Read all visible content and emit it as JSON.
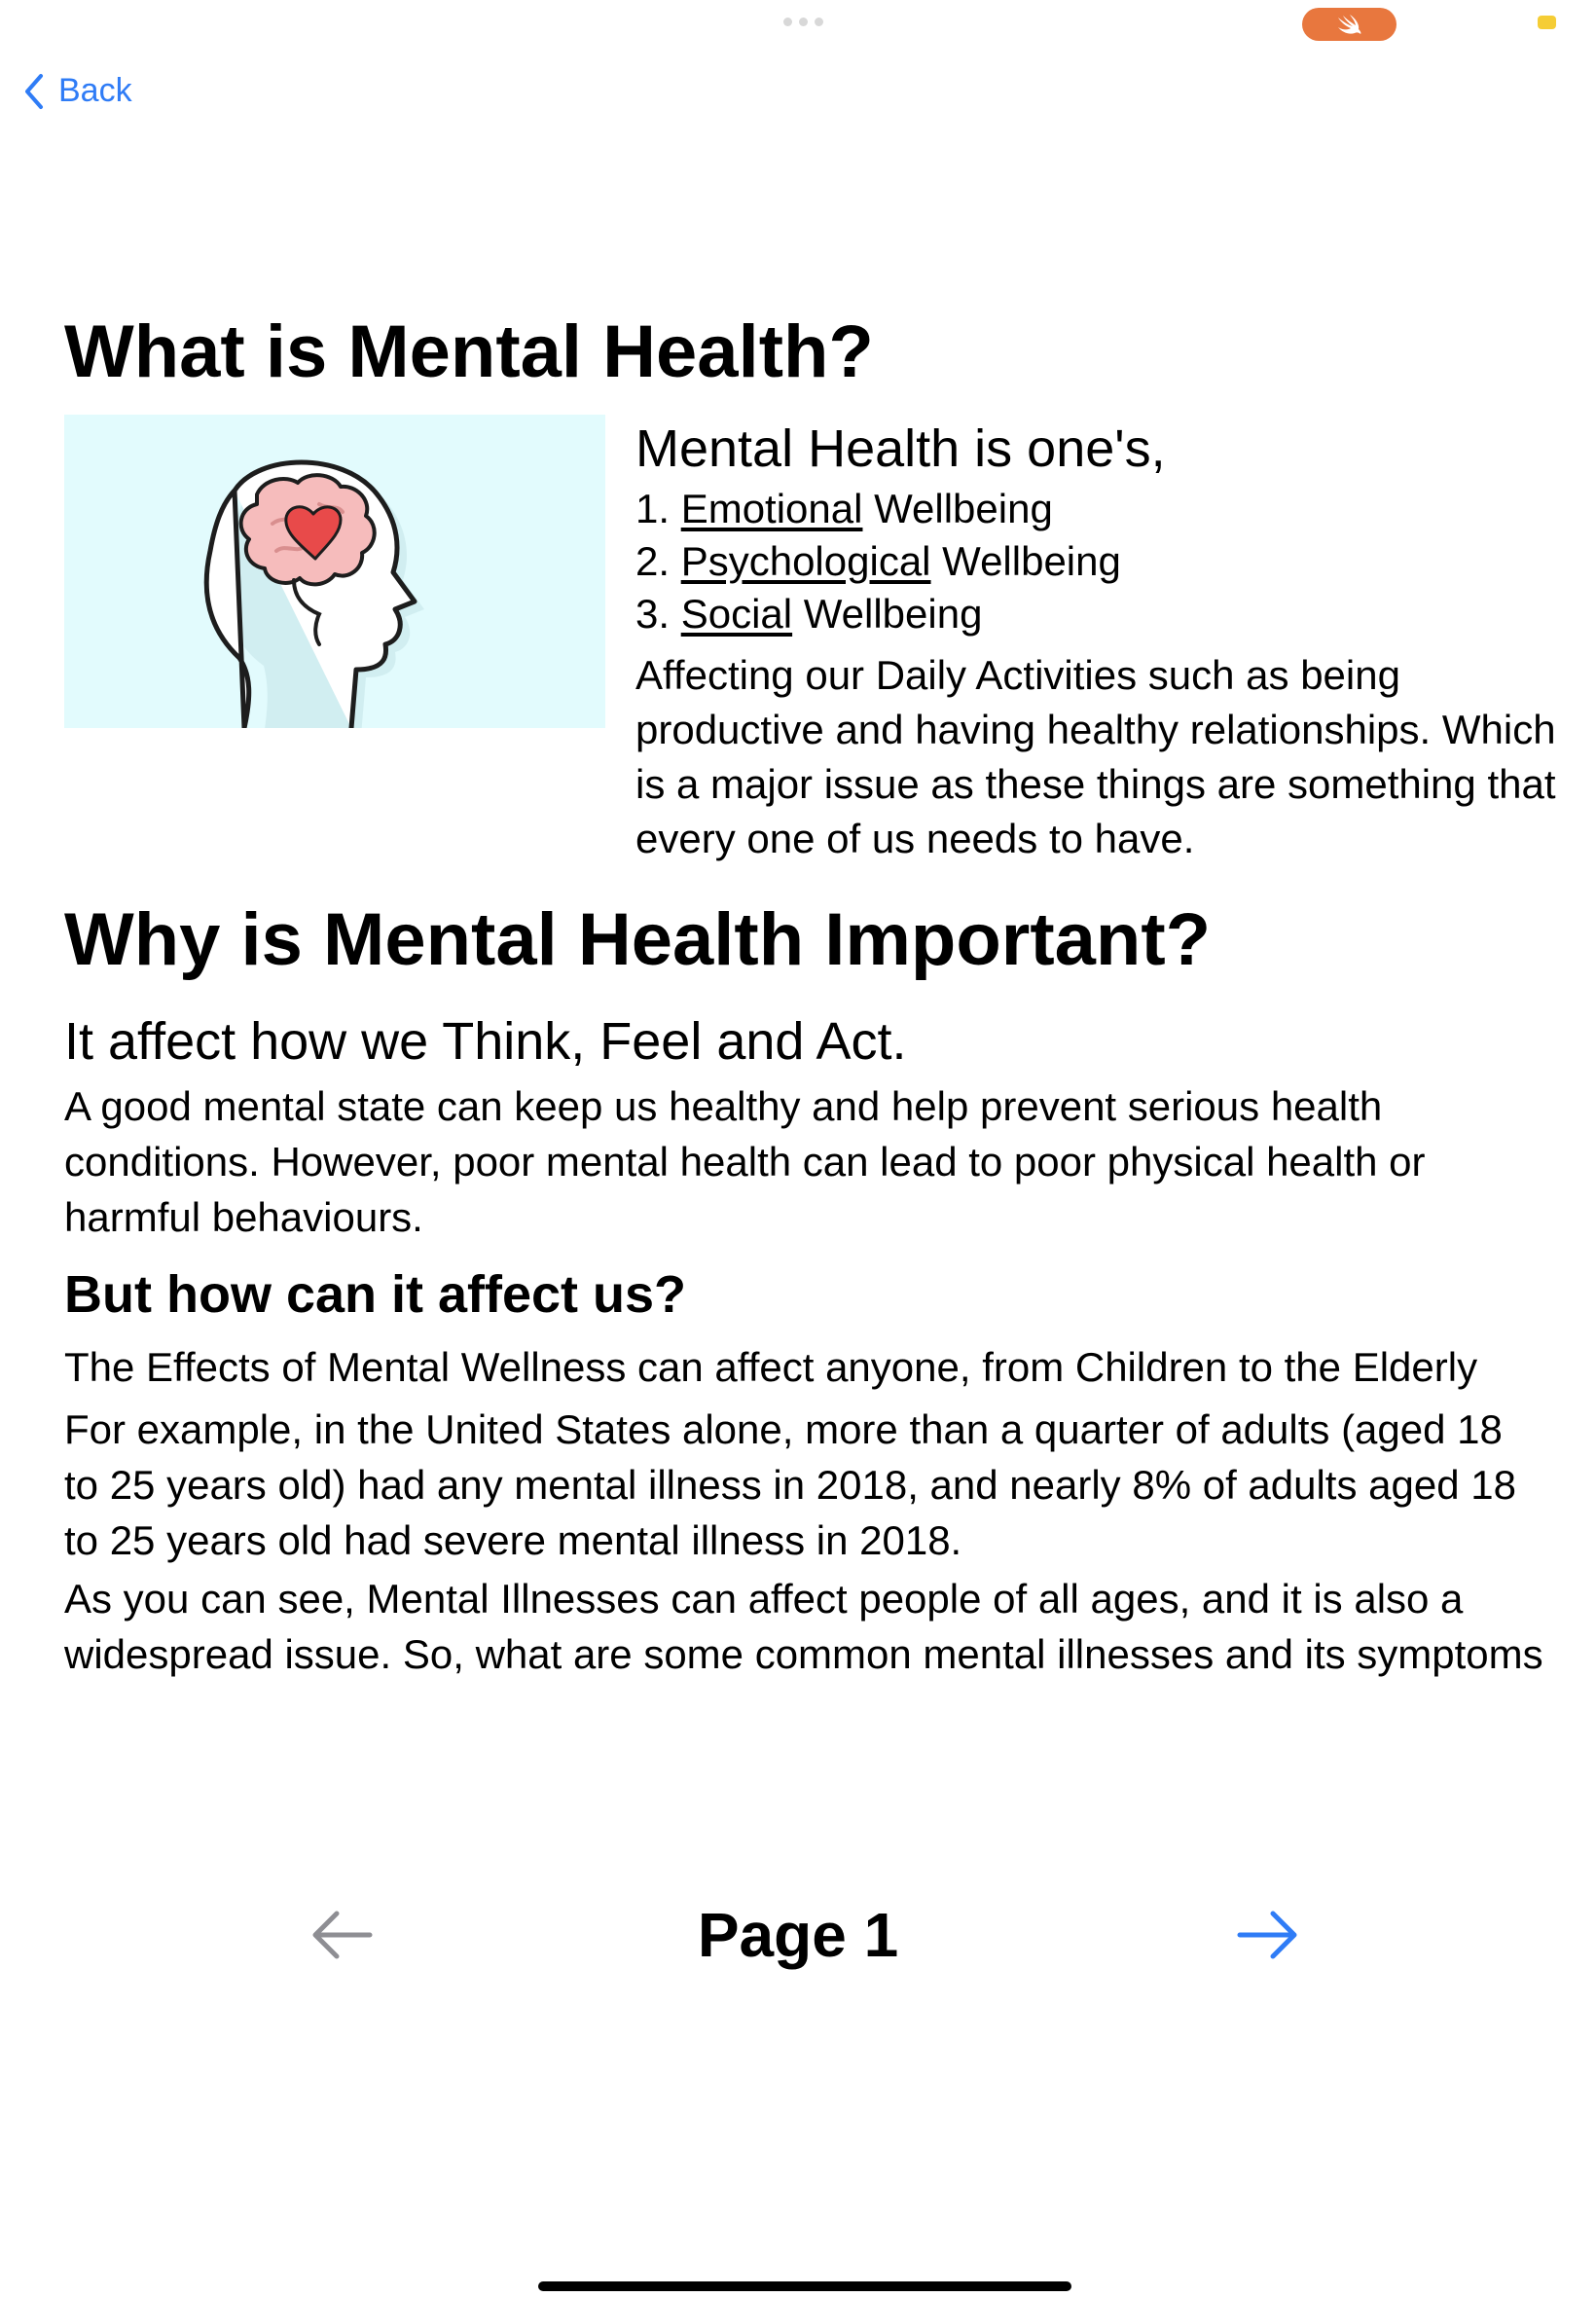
{
  "nav": {
    "back_label": "Back"
  },
  "section1": {
    "title": "What is Mental Health?",
    "image_alt": "head-with-brain-and-heart-illustration",
    "lead": "Mental Health is one's,",
    "items": [
      {
        "num": "1.",
        "term": "Emotional",
        "rest": " Wellbeing"
      },
      {
        "num": "2.",
        "term": "Psychological",
        "rest": " Wellbeing"
      },
      {
        "num": "3.",
        "term": "Social",
        "rest": " Wellbeing"
      }
    ],
    "paragraph": "Affecting our Daily Activities such as being productive and having healthy relationships. Which is a major issue as these things are something that every one of us needs to have."
  },
  "section2": {
    "title": "Why is Mental Health Important?",
    "lead": "It affect how we Think, Feel and Act.",
    "paragraph": "A good mental state can keep us healthy and help prevent serious health conditions. However, poor mental health can lead to poor physical health or harmful behaviours.",
    "subtitle": "But how can it affect us?",
    "para_effects": "The Effects of Mental Wellness can affect anyone, from Children to the Elderly",
    "para_example": "For example, in the United States alone, more than a quarter of adults (aged 18 to 25 years old) had any mental illness in 2018, and nearly 8% of adults aged 18 to 25 years old had severe mental illness in 2018.",
    "para_conclusion": "As you can see, Mental Illnesses can affect people of all ages, and it is also a widespread issue. So, what are some common mental illnesses and its symptoms"
  },
  "pager": {
    "label": "Page 1"
  },
  "colors": {
    "accent": "#2f7cf6",
    "swift_badge": "#e8773e",
    "indicator_yellow": "#f5cd35",
    "image_bg": "#e2fbfd",
    "disabled_arrow": "#8e8e93"
  },
  "icons": [
    "chevron-left-icon",
    "swift-icon",
    "arrow-left-icon",
    "arrow-right-icon"
  ]
}
